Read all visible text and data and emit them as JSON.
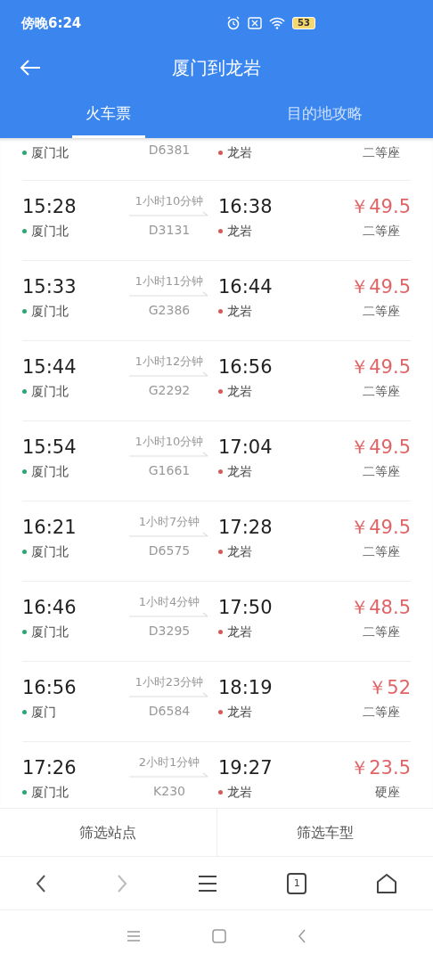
{
  "status_bar": {
    "time": "傍晚6:24",
    "battery": "53"
  },
  "header": {
    "title": "厦门到龙岩"
  },
  "tabs": [
    {
      "label": "火车票",
      "selected": true
    },
    {
      "label": "目的地攻略",
      "selected": false
    }
  ],
  "trains": [
    {
      "from_station": "厦门北",
      "train": "D6381",
      "to_station": "龙岩",
      "seat": "二等座"
    },
    {
      "depart": "15:28",
      "from_station": "厦门北",
      "duration": "1小时10分钟",
      "train": "D3131",
      "arrive": "16:38",
      "to_station": "龙岩",
      "price": "￥49.5",
      "seat": "二等座"
    },
    {
      "depart": "15:33",
      "from_station": "厦门北",
      "duration": "1小时11分钟",
      "train": "G2386",
      "arrive": "16:44",
      "to_station": "龙岩",
      "price": "￥49.5",
      "seat": "二等座"
    },
    {
      "depart": "15:44",
      "from_station": "厦门北",
      "duration": "1小时12分钟",
      "train": "G2292",
      "arrive": "16:56",
      "to_station": "龙岩",
      "price": "￥49.5",
      "seat": "二等座"
    },
    {
      "depart": "15:54",
      "from_station": "厦门北",
      "duration": "1小时10分钟",
      "train": "G1661",
      "arrive": "17:04",
      "to_station": "龙岩",
      "price": "￥49.5",
      "seat": "二等座"
    },
    {
      "depart": "16:21",
      "from_station": "厦门北",
      "duration": "1小时7分钟",
      "train": "D6575",
      "arrive": "17:28",
      "to_station": "龙岩",
      "price": "￥49.5",
      "seat": "二等座"
    },
    {
      "depart": "16:46",
      "from_station": "厦门北",
      "duration": "1小时4分钟",
      "train": "D3295",
      "arrive": "17:50",
      "to_station": "龙岩",
      "price": "￥48.5",
      "seat": "二等座"
    },
    {
      "depart": "16:56",
      "from_station": "厦门",
      "duration": "1小时23分钟",
      "train": "D6584",
      "arrive": "18:19",
      "to_station": "龙岩",
      "price": "￥52",
      "seat": "二等座"
    },
    {
      "depart": "17:26",
      "from_station": "厦门北",
      "duration": "2小时1分钟",
      "train": "K230",
      "arrive": "19:27",
      "to_station": "龙岩",
      "price": "￥23.5",
      "seat": "硬座"
    }
  ],
  "filters": [
    "筛选站点",
    "筛选车型"
  ],
  "browser_bar": {
    "tab_count": "1"
  }
}
